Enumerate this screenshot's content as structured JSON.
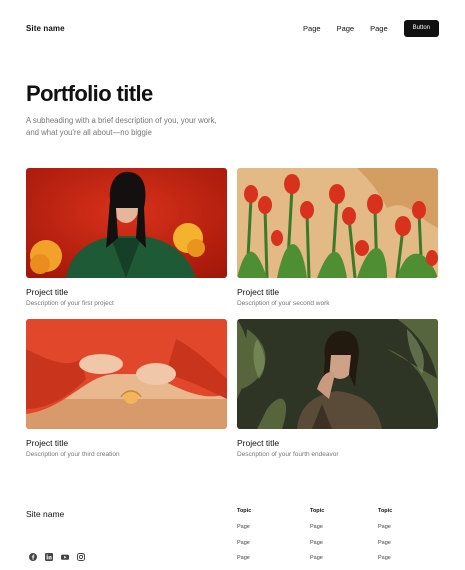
{
  "nav": {
    "site_name": "Site name",
    "links": [
      "Page",
      "Page",
      "Page"
    ],
    "button_label": "Button"
  },
  "hero": {
    "title": "Portfolio title",
    "subheading": "A subheading with a brief description of you, your work, and what you're all about—no biggie"
  },
  "projects": [
    {
      "title": "Project title",
      "description": "Description of your first project"
    },
    {
      "title": "Project title",
      "description": "Description of your second work"
    },
    {
      "title": "Project title",
      "description": "Description of your third creation"
    },
    {
      "title": "Project title",
      "description": "Description of your fourth endeavor"
    }
  ],
  "footer": {
    "site_name": "Site name",
    "social_icons": [
      "facebook-icon",
      "linkedin-icon",
      "youtube-icon",
      "instagram-icon"
    ],
    "columns": [
      {
        "heading": "Topic",
        "links": [
          "Page",
          "Page",
          "Page"
        ]
      },
      {
        "heading": "Topic",
        "links": [
          "Page",
          "Page",
          "Page"
        ]
      },
      {
        "heading": "Topic",
        "links": [
          "Page",
          "Page",
          "Page"
        ]
      }
    ]
  },
  "colors": {
    "text": "#111111",
    "muted": "#777777",
    "button_bg": "#111111",
    "button_text": "#ffffff"
  }
}
